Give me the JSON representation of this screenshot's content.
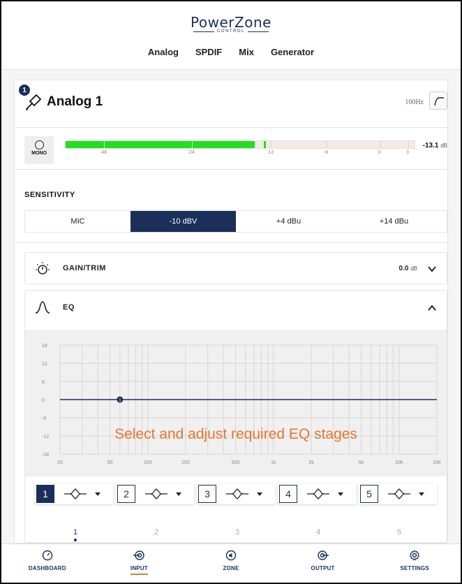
{
  "brand": {
    "name": "PowerZone",
    "sub": "CONTROL"
  },
  "tabs": [
    {
      "label": "Analog",
      "active": true
    },
    {
      "label": "SPDIF",
      "active": false
    },
    {
      "label": "Mix",
      "active": false
    },
    {
      "label": "Generator",
      "active": false
    }
  ],
  "channel": {
    "badge": "1",
    "title": "Analog 1",
    "icon": "microphone-icon",
    "hpf_label": "100Hz",
    "hpf_icon": "highpass-icon"
  },
  "meter": {
    "mono_label": "MONO",
    "scale": [
      "-48",
      "-24",
      "-12",
      "-6",
      "0",
      "3"
    ],
    "level_db": -13.8,
    "peak_db": -13.1,
    "value": "-13.1",
    "unit": "dB",
    "colors": {
      "fill": "#20e020",
      "track": "#f3ece6"
    }
  },
  "sensitivity": {
    "title": "SENSITIVITY",
    "options": [
      "MIC",
      "-10 dBV",
      "+4 dBu",
      "+14 dBu"
    ],
    "selected": "-10 dBV"
  },
  "gain": {
    "label": "GAIN/TRIM",
    "value": "0.0",
    "unit": "dB",
    "icon": "knob-icon",
    "expanded": false
  },
  "eq": {
    "label": "EQ",
    "icon": "eq-curve-icon",
    "expanded": true,
    "graph": {
      "y_ticks": [
        "18",
        "12",
        "6",
        "0",
        "-6",
        "-12",
        "-18"
      ],
      "x_ticks": [
        "20",
        "50",
        "100",
        "200",
        "500",
        "1k",
        "2k",
        "5k",
        "10k",
        "20k"
      ],
      "y_range": [
        -18,
        18
      ],
      "x_range_hz": [
        20,
        20000
      ],
      "curve_gain_db": 0,
      "marker": {
        "label": "1",
        "freq_hz": 60,
        "gain_db": 0
      },
      "overlay": "Select and adjust required EQ stages"
    },
    "stages": [
      {
        "num": "1",
        "active": true,
        "filter": "bell-filter-icon"
      },
      {
        "num": "2",
        "active": false,
        "filter": "bell-filter-icon"
      },
      {
        "num": "3",
        "active": false,
        "filter": "bell-filter-icon"
      },
      {
        "num": "4",
        "active": false,
        "filter": "bell-filter-icon"
      },
      {
        "num": "5",
        "active": false,
        "filter": "bell-filter-icon"
      }
    ],
    "pages": [
      "1",
      "2",
      "3",
      "4",
      "5"
    ],
    "current_page": "1"
  },
  "nav": [
    {
      "label": "DASHBOARD",
      "icon": "gauge-icon",
      "active": false
    },
    {
      "label": "INPUT",
      "icon": "input-icon",
      "active": true
    },
    {
      "label": "ZONE",
      "icon": "speaker-icon",
      "active": false
    },
    {
      "label": "OUTPUT",
      "icon": "output-icon",
      "active": false
    },
    {
      "label": "SETTINGS",
      "icon": "gear-icon",
      "active": false
    }
  ],
  "colors": {
    "accent": "#e8762c",
    "brand": "#1a2f5a"
  }
}
